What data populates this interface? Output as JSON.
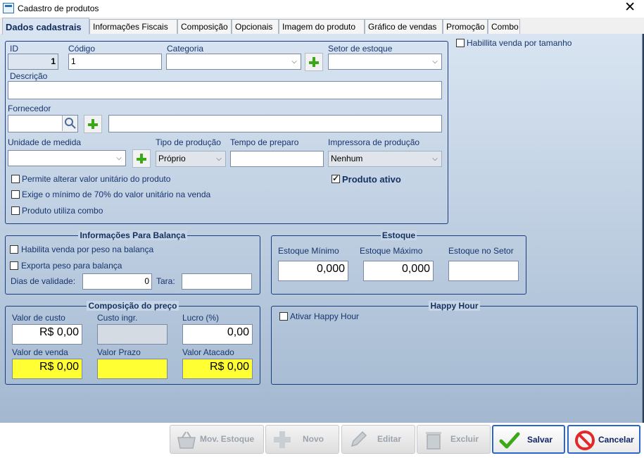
{
  "window": {
    "title": "Cadastro de produtos",
    "close_glyph": "✕"
  },
  "tabs": [
    "Dados cadastrais",
    "Informações Fiscais",
    "Composição",
    "Opcionais",
    "Imagem do produto",
    "Gráfico de vendas",
    "Promoção",
    "Combo"
  ],
  "side_option": {
    "label": "Habillita venda por tamanho",
    "checked": false
  },
  "basic": {
    "id_label": "ID",
    "id_value": "1",
    "codigo_label": "Código",
    "codigo_value": "1",
    "categoria_label": "Categoria",
    "categoria_value": "",
    "setor_label": "Setor de estoque",
    "setor_value": "",
    "descricao_label": "Descrição",
    "descricao_value": "",
    "fornecedor_label": "Fornecedor",
    "fornecedor_value": "",
    "fornecedor_nome": "",
    "unidade_label": "Unidade de medida",
    "unidade_value": "",
    "tipo_label": "Tipo de produção",
    "tipo_value": "Próprio",
    "tempo_label": "Tempo de preparo",
    "tempo_value": "",
    "impressora_label": "Impressora de produção",
    "impressora_value": "Nenhum",
    "permite_alterar": "Permite alterar valor unitário do produto",
    "exige_minimo": "Exige o mínimo de 70% do valor unitário na venda",
    "utiliza_combo": "Produto utiliza combo",
    "produto_ativo": "Produto ativo"
  },
  "balanca": {
    "title": "Informações Para Balança",
    "habilita": "Habilita venda por peso na balança",
    "exporta": "Exporta peso para balança",
    "dias_label": "Dias de validade:",
    "dias_value": "0",
    "tara_label": "Tara:",
    "tara_value": ""
  },
  "estoque": {
    "title": "Estoque",
    "minimo_label": "Estoque Mínimo",
    "minimo_value": "0,000",
    "maximo_label": "Estoque Máximo",
    "maximo_value": "0,000",
    "setor_label": "Estoque no Setor",
    "setor_value": ""
  },
  "preco": {
    "title": "Composição do preço",
    "custo_label": "Valor de custo",
    "custo_value": "R$ 0,00",
    "custo_ingr_label": "Custo ingr.",
    "custo_ingr_value": "",
    "lucro_label": "Lucro (%)",
    "lucro_value": "0,00",
    "venda_label": "Valor de venda",
    "venda_value": "R$ 0,00",
    "prazo_label": "Valor Prazo",
    "prazo_value": "",
    "atacado_label": "Valor Atacado",
    "atacado_value": "R$ 0,00"
  },
  "happy": {
    "title": "Happy Hour",
    "ativar": "Ativar Happy Hour"
  },
  "buttons": {
    "mov_estoque": "Mov. Estoque",
    "novo": "Novo",
    "editar": "Editar",
    "excluir": "Excluir",
    "salvar": "Salvar",
    "cancelar": "Cancelar"
  },
  "colors": {
    "accent": "#1b3a80",
    "highlight_field": "#ffff33",
    "save_icon": "#3ba818",
    "cancel_icon": "#e0292b"
  }
}
